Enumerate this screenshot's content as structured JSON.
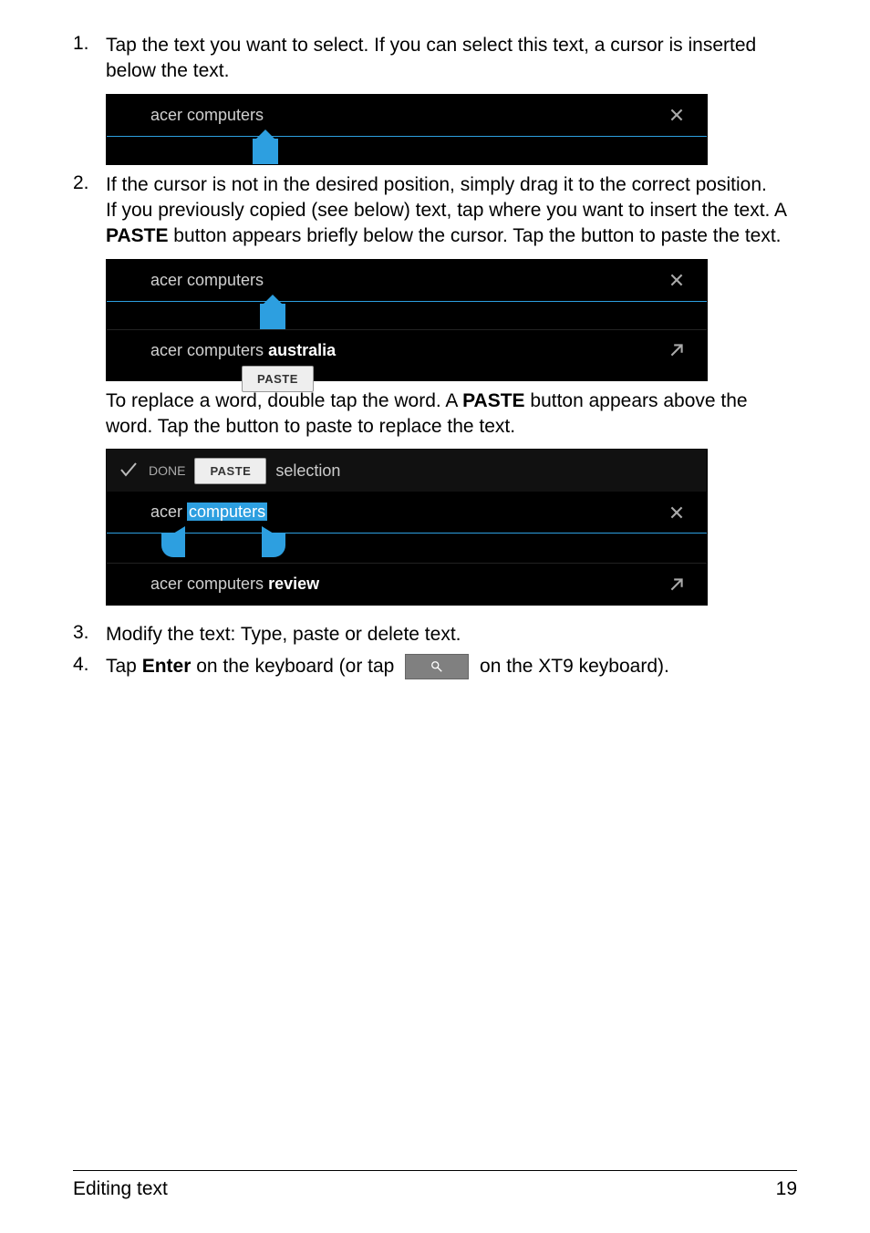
{
  "steps": {
    "s1": {
      "num": "1.",
      "text": "Tap the text you want to select. If you can select this text, a cursor is inserted below the text."
    },
    "s2": {
      "num": "2.",
      "line1": "If the cursor is not in the desired position, simply drag it to the correct position.",
      "line2a": "If you previously copied (see below) text, tap where you want to insert the text. A ",
      "line2b_bold": "PASTE",
      "line2c": " button appears briefly below the cursor. Tap the button to paste the text.",
      "after2a": "To replace a word, double tap the word. A ",
      "after2b_bold": "PASTE",
      "after2c": " button appears above the word. Tap the button to paste to replace the text."
    },
    "s3": {
      "num": "3.",
      "text": "Modify the text: Type, paste or delete text."
    },
    "s4": {
      "num": "4.",
      "a": "Tap ",
      "b_bold": "Enter",
      "c": " on the keyboard (or tap ",
      "d": " on the XT9 keyboard)."
    }
  },
  "shot1": {
    "input": "acer computers"
  },
  "shot2": {
    "input": "acer computers",
    "suggest_prefix": "acer computers ",
    "suggest_bold": "australia",
    "paste": "PASTE"
  },
  "shot3": {
    "done": "DONE",
    "paste": "PASTE",
    "selection_label": "selection",
    "input_prefix": "acer ",
    "input_sel": "computers",
    "suggest_prefix": "acer computers ",
    "suggest_bold": "review"
  },
  "footer": {
    "left": "Editing text",
    "right": "19"
  }
}
